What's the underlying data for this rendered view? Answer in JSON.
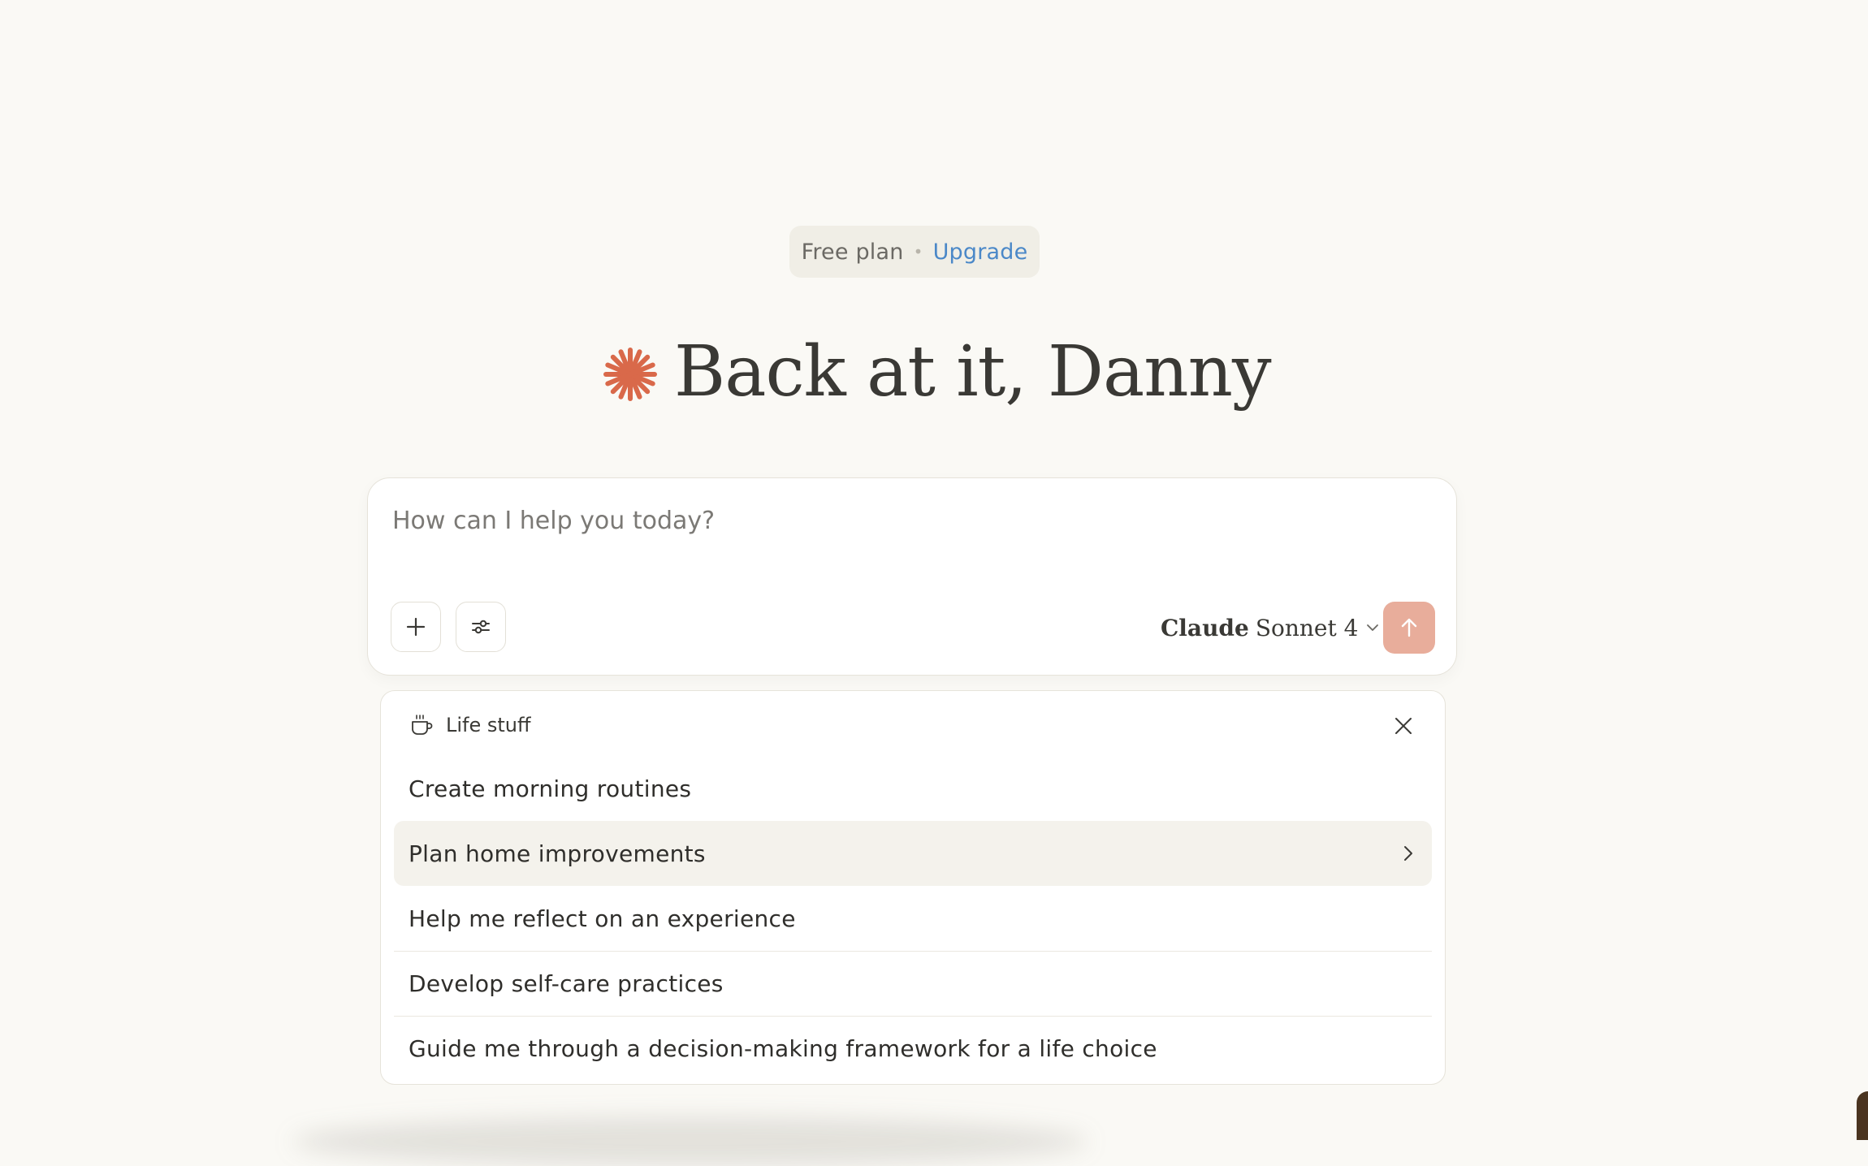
{
  "plan": {
    "label": "Free plan",
    "separator": "•",
    "upgrade_label": "Upgrade"
  },
  "greeting": {
    "text": "Back at it, Danny",
    "icon": "spark-icon",
    "icon_color": "#d9694a"
  },
  "composer": {
    "placeholder": "How can I help you today?",
    "value": "",
    "add_icon": "plus-icon",
    "tools_icon": "sliders-icon",
    "model": {
      "brand": "Claude",
      "name": "Sonnet 4",
      "icon": "chevron-down-icon"
    },
    "send_icon": "arrow-up-icon",
    "send_color": "#e8ad9b"
  },
  "suggestions": {
    "category": "Life stuff",
    "category_icon": "coffee-cup-icon",
    "close_icon": "close-icon",
    "items": [
      {
        "label": "Create morning routines"
      },
      {
        "label": "Plan home improvements"
      },
      {
        "label": "Help me reflect on an experience"
      },
      {
        "label": "Develop self-care practices"
      },
      {
        "label": "Guide me through a decision-making framework for a life choice"
      }
    ],
    "active_index": 1
  }
}
